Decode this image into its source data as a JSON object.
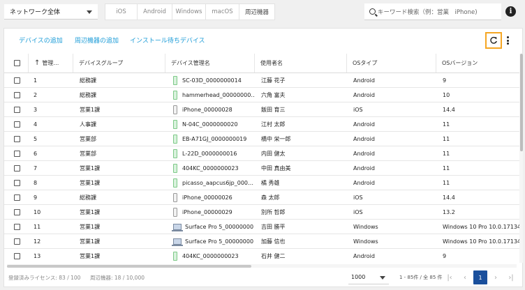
{
  "topbar": {
    "network_select": "ネットワーク全体",
    "os_filters": [
      "iOS",
      "Android",
      "Windows",
      "macOS",
      "周辺機器"
    ],
    "search_placeholder": "キーワード検索（例：営業　iPhone)"
  },
  "actions": {
    "add_device": "デバイスの追加",
    "add_peripheral": "周辺機器の追加",
    "install_waiting": "インストール待ちデバイス"
  },
  "table": {
    "columns": [
      "管理…",
      "デバイスグループ",
      "デバイス管理名",
      "使用者名",
      "OSタイプ",
      "OSバージョン"
    ],
    "rows": [
      {
        "id": "1",
        "group": "総務課",
        "name": "SC-03D_0000000014",
        "user": "江藤 花子",
        "os": "Android",
        "ver": "9",
        "icon": "android-phone-icon"
      },
      {
        "id": "2",
        "group": "総務課",
        "name": "hammerhead_00000000…",
        "user": "六角 富夫",
        "os": "Android",
        "ver": "10",
        "icon": "android-phone-icon"
      },
      {
        "id": "3",
        "group": "営業1課",
        "name": "iPhone_00000028",
        "user": "飯田 育三",
        "os": "iOS",
        "ver": "14.4",
        "icon": "iphone-icon"
      },
      {
        "id": "4",
        "group": "人事課",
        "name": "N-04C_0000000020",
        "user": "江村 太郎",
        "os": "Android",
        "ver": "11",
        "icon": "android-phone-icon"
      },
      {
        "id": "5",
        "group": "営業部",
        "name": "EB-A71GJ_0000000019",
        "user": "橋中 栄一郎",
        "os": "Android",
        "ver": "11",
        "icon": "android-phone-icon"
      },
      {
        "id": "6",
        "group": "営業部",
        "name": "L-22D_0000000016",
        "user": "内田 健太",
        "os": "Android",
        "ver": "11",
        "icon": "android-phone-icon"
      },
      {
        "id": "7",
        "group": "営業1課",
        "name": "404KC_0000000023",
        "user": "中田 真由美",
        "os": "Android",
        "ver": "11",
        "icon": "android-phone-icon"
      },
      {
        "id": "8",
        "group": "営業1課",
        "name": "picasso_aapcus6jp_000…",
        "user": "橘 秀雄",
        "os": "Android",
        "ver": "11",
        "icon": "android-phone-icon"
      },
      {
        "id": "9",
        "group": "総務課",
        "name": "iPhone_00000026",
        "user": "森 太郎",
        "os": "iOS",
        "ver": "14.4",
        "icon": "iphone-icon"
      },
      {
        "id": "10",
        "group": "営業1課",
        "name": "iPhone_00000029",
        "user": "別所 哲郎",
        "os": "iOS",
        "ver": "13.2",
        "icon": "iphone-icon"
      },
      {
        "id": "11",
        "group": "営業1課",
        "name": "Surface Pro 5_00000000…",
        "user": "吉田 勝平",
        "os": "Windows",
        "ver": "Windows 10 Pro 10.0.17134",
        "icon": "laptop-icon"
      },
      {
        "id": "12",
        "group": "営業1課",
        "name": "Surface Pro 5_00000000…",
        "user": "加藤 信也",
        "os": "Windows",
        "ver": "Windows 10 Pro 10.0.17134",
        "icon": "laptop-icon"
      },
      {
        "id": "13",
        "group": "営業1課",
        "name": "404KC_0000000023",
        "user": "石井 健二",
        "os": "Android",
        "ver": "9",
        "icon": "android-phone-icon"
      }
    ]
  },
  "footer": {
    "licenses": "登録済みライセンス: 83 / 100",
    "peripherals": "周辺機器: 18 / 10,000",
    "page_size": "1000",
    "range": "1 - 85件 / 全 85 件",
    "current_page": "1"
  },
  "colors": {
    "accent": "#1a9bd7",
    "highlight": "#f5a623",
    "pager_active": "#1a4f9c"
  }
}
